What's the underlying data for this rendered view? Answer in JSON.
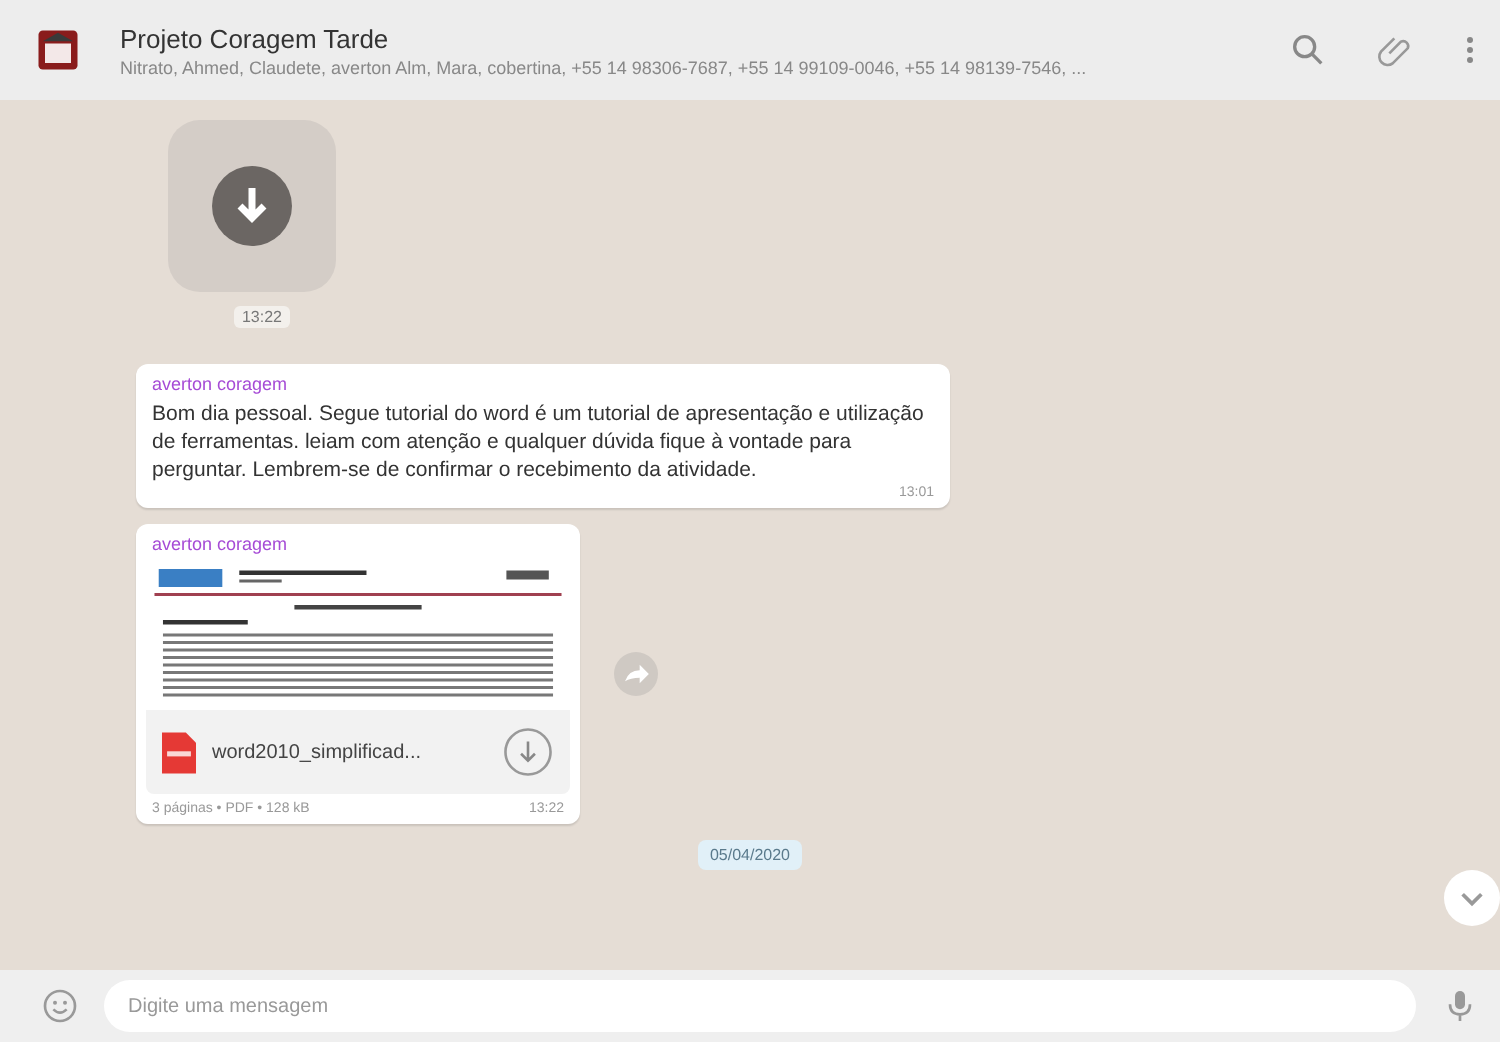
{
  "header": {
    "title": "Projeto Coragem Tarde",
    "subtitle": "Nitrato, Ahmed, Claudete, averton Alm, Mara, cobertina, +55 14 98306-7687, +55 14 99109-0046, +55 14 98139-7546, ..."
  },
  "messages": [
    {
      "kind": "image",
      "time": "13:22"
    },
    {
      "kind": "text",
      "author": "averton coragem",
      "text": "Bom dia pessoal. Segue tutorial do word é um tutorial de apresentação e utilização de ferramentas. leiam com atenção e qualquer dúvida fique à vontade para perguntar. Lembrem-se de confirmar o recebimento da atividade.",
      "time": "13:01"
    },
    {
      "kind": "document",
      "author": "averton coragem",
      "file_name": "word2010_simplificad...",
      "meta": "3 páginas • PDF • 128 kB",
      "time": "13:22"
    }
  ],
  "date_badge": "05/04/2020",
  "composer": {
    "placeholder": "Digite uma mensagem"
  }
}
